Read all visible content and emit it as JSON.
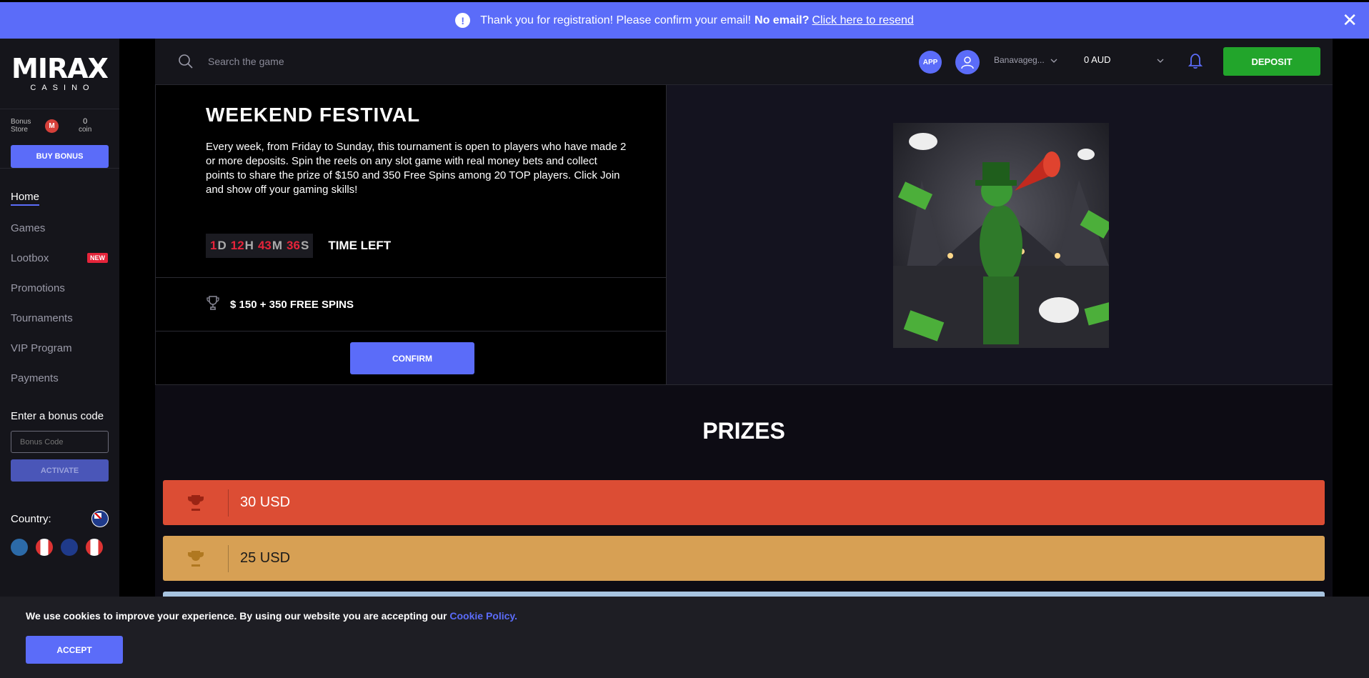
{
  "banner": {
    "message": "Thank you for registration! Please confirm your email!",
    "no_email": "No email?",
    "resend_link": "Click here to resend",
    "close": "✕"
  },
  "sidebar": {
    "logo_main": "MIRAX",
    "logo_sub": "CASINO",
    "bonus_store_label": "Bonus Store",
    "coin_badge": "M",
    "coin_count": "0",
    "coin_label": "coin",
    "buy_bonus": "BUY BONUS",
    "nav": [
      {
        "label": "Home"
      },
      {
        "label": "Games"
      },
      {
        "label": "Lootbox",
        "badge": "NEW"
      },
      {
        "label": "Promotions"
      },
      {
        "label": "Tournaments"
      },
      {
        "label": "VIP Program"
      },
      {
        "label": "Payments"
      }
    ],
    "bonus_code_title": "Enter a bonus code",
    "bonus_code_placeholder": "Bonus Code",
    "activate": "ACTIVATE",
    "country_label": "Country:"
  },
  "topbar": {
    "search_placeholder": "Search the game",
    "app_label": "APP",
    "username": "Banavageg...",
    "balance": "0 AUD",
    "deposit": "DEPOSIT"
  },
  "tournament": {
    "title": "WEEKEND FESTIVAL",
    "description": "Every week, from Friday to Sunday, this tournament is open to players who have made 2 or more deposits. Spin the reels on any slot game with real money bets and collect points to share the prize of $150 and 350 Free Spins among 20 TOP players. Click Join and show off your gaming skills!",
    "timer": {
      "days": "1",
      "days_unit": "D",
      "hours": "12",
      "hours_unit": "H",
      "minutes": "43",
      "minutes_unit": "M",
      "seconds": "36",
      "seconds_unit": "S"
    },
    "time_left_label": "TIME LEFT",
    "prize_summary": "$ 150 + 350 FREE SPINS",
    "confirm": "CONFIRM"
  },
  "prizes": {
    "title": "PRIZES",
    "items": [
      {
        "amount": "30 USD",
        "color": "#dc4d34"
      },
      {
        "amount": "25 USD",
        "color": "#d7a054"
      }
    ]
  },
  "cookie": {
    "text": "We use cookies to improve your experience. By using our website you are accepting our",
    "link": "Cookie Policy.",
    "accept": "ACCEPT"
  },
  "colors": {
    "accent": "#5b6cf9",
    "deposit": "#22a52b",
    "timer_red": "#e5243a"
  }
}
